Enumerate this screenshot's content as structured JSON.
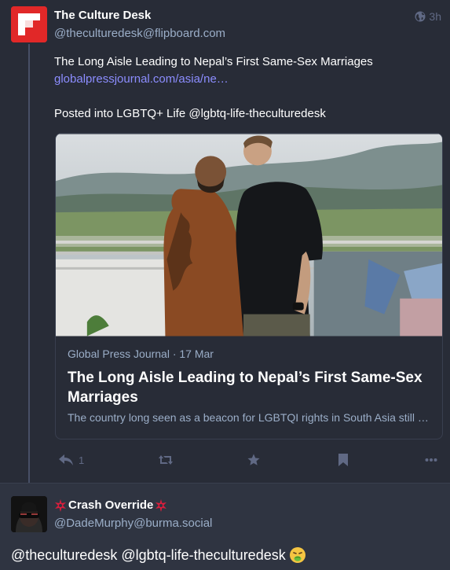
{
  "status": {
    "display_name": "The Culture Desk",
    "account": "@theculturedesk@flipboard.com",
    "time": "3h",
    "content": {
      "title_line": "The Long Aisle Leading to Nepal’s First Same-Sex Marriages",
      "link": "globalpressjournal.com/asia/ne…",
      "posted_into": "Posted into LGBTQ+ Life @lgbtq-life-theculturedesk"
    },
    "card": {
      "meta": "Global Press Journal · 17 Mar",
      "title": "The Long Aisle Leading to Nepal’s First Same-Sex Marriages",
      "description": "The country long seen as a beacon for LGBTQI rights in South Asia still h…"
    },
    "actions": {
      "reply_count": "1",
      "reply_icon": "reply-icon",
      "boost_icon": "retweet-icon",
      "favourite_icon": "star-icon",
      "bookmark_icon": "bookmark-icon",
      "more_icon": "ellipsis-icon"
    }
  },
  "reply": {
    "display_name": "Crash Override",
    "name_emoji": "hacker-star-emoji",
    "account": "@DadeMurphy@burma.social",
    "content": "@theculturedesk @lgbtq-life-theculturedesk",
    "content_emoji": "nauseated-face-emoji"
  },
  "colors": {
    "background": "#282c37",
    "secondary_text": "#9baec8",
    "link": "#8c8dff",
    "icon": "#606984",
    "flipboard_red": "#e12828"
  }
}
